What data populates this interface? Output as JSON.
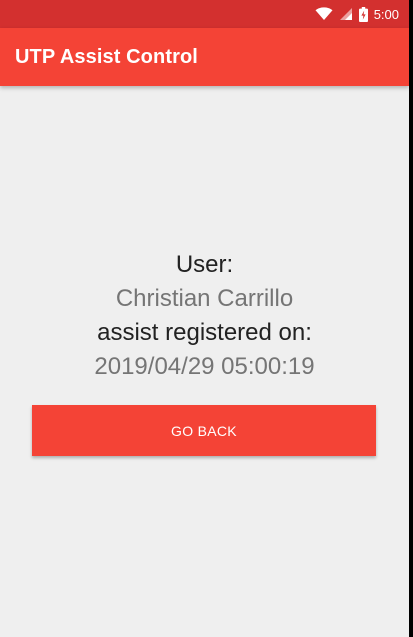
{
  "status_bar": {
    "time": "5:00",
    "icons": [
      "wifi-icon",
      "signal-icon",
      "battery-charging-icon"
    ],
    "color": "#d3302f"
  },
  "app_bar": {
    "title": "UTP Assist Control",
    "color": "#f44336"
  },
  "main": {
    "user_label": "User:",
    "user_name": "Christian Carrillo",
    "registered_label": "assist registered on:",
    "registered_datetime": "2019/04/29 05:00:19"
  },
  "actions": {
    "go_back_label": "GO BACK",
    "button_color": "#f44336"
  },
  "colors": {
    "background": "#efefef",
    "primary_text": "#222222",
    "secondary_text": "#757575"
  }
}
